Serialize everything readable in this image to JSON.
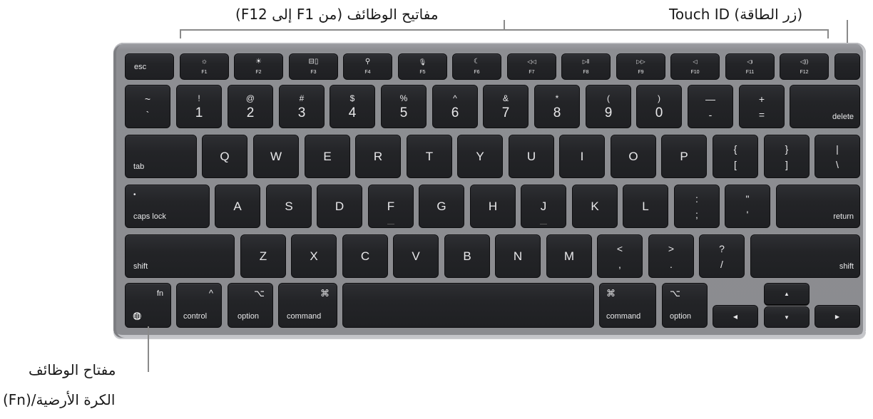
{
  "callouts": {
    "function_keys": "مفاتيح الوظائف (من F1 إلى F12)",
    "touch_id": "Touch ID (زر الطاقة)",
    "fn_line1": "مفتاح الوظائف",
    "fn_line2": "(Fn)/الكرة الأرضية"
  },
  "keyboard": {
    "row_function": [
      {
        "label": "esc"
      },
      {
        "icon": "brightness-down-icon",
        "glyph": "☼",
        "label": "F1"
      },
      {
        "icon": "brightness-up-icon",
        "glyph": "☀",
        "label": "F2"
      },
      {
        "icon": "mission-control-icon",
        "glyph": "⊟▯",
        "label": "F3"
      },
      {
        "icon": "search-icon",
        "glyph": "⚲",
        "label": "F4"
      },
      {
        "icon": "microphone-icon",
        "glyph": "🎙",
        "label": "F5"
      },
      {
        "icon": "moon-icon",
        "glyph": "☾",
        "label": "F6"
      },
      {
        "icon": "rewind-icon",
        "glyph": "◁◁",
        "label": "F7"
      },
      {
        "icon": "play-pause-icon",
        "glyph": "▷‖",
        "label": "F8"
      },
      {
        "icon": "fast-forward-icon",
        "glyph": "▷▷",
        "label": "F9"
      },
      {
        "icon": "mute-icon",
        "glyph": "◁",
        "label": "F10"
      },
      {
        "icon": "volume-down-icon",
        "glyph": "◁ı",
        "label": "F11"
      },
      {
        "icon": "volume-up-icon",
        "glyph": "◁))",
        "label": "F12"
      },
      {
        "label": ""
      }
    ],
    "row_number": [
      {
        "top": "~",
        "bottom": "`"
      },
      {
        "top": "!",
        "bottom": "1"
      },
      {
        "top": "@",
        "bottom": "2"
      },
      {
        "top": "#",
        "bottom": "3"
      },
      {
        "top": "$",
        "bottom": "4"
      },
      {
        "top": "%",
        "bottom": "5"
      },
      {
        "top": "^",
        "bottom": "6"
      },
      {
        "top": "&",
        "bottom": "7"
      },
      {
        "top": "*",
        "bottom": "8"
      },
      {
        "top": "(",
        "bottom": "9"
      },
      {
        "top": ")",
        "bottom": "0"
      },
      {
        "top": "—",
        "bottom": "-"
      },
      {
        "top": "+",
        "bottom": "="
      },
      {
        "label": "delete"
      }
    ],
    "row_top": [
      {
        "label": "tab"
      },
      {
        "label": "Q"
      },
      {
        "label": "W"
      },
      {
        "label": "E"
      },
      {
        "label": "R"
      },
      {
        "label": "T"
      },
      {
        "label": "Y"
      },
      {
        "label": "U"
      },
      {
        "label": "I"
      },
      {
        "label": "O"
      },
      {
        "label": "P"
      },
      {
        "top": "{",
        "bottom": "["
      },
      {
        "top": "}",
        "bottom": "]"
      },
      {
        "top": "|",
        "bottom": "\\"
      }
    ],
    "row_home": [
      {
        "label": "caps lock",
        "indicator": "•"
      },
      {
        "label": "A"
      },
      {
        "label": "S"
      },
      {
        "label": "D"
      },
      {
        "label": "F"
      },
      {
        "label": "G"
      },
      {
        "label": "H"
      },
      {
        "label": "J"
      },
      {
        "label": "K"
      },
      {
        "label": "L"
      },
      {
        "top": ":",
        "bottom": ";"
      },
      {
        "top": "\"",
        "bottom": "'"
      },
      {
        "label": "return"
      }
    ],
    "row_bottom": [
      {
        "label": "shift"
      },
      {
        "label": "Z"
      },
      {
        "label": "X"
      },
      {
        "label": "C"
      },
      {
        "label": "V"
      },
      {
        "label": "B"
      },
      {
        "label": "N"
      },
      {
        "label": "M"
      },
      {
        "top": "<",
        "bottom": ","
      },
      {
        "top": ">",
        "bottom": "."
      },
      {
        "top": "?",
        "bottom": "/"
      },
      {
        "label": "shift"
      }
    ],
    "row_modifier": {
      "fn": {
        "label": "fn",
        "globe": "🌐"
      },
      "control": {
        "label": "control",
        "symbol": "^"
      },
      "option_left": {
        "label": "option",
        "symbol": "⌥"
      },
      "command_left": {
        "label": "command",
        "symbol": "⌘"
      },
      "command_right": {
        "label": "command",
        "symbol": "⌘"
      },
      "option_right": {
        "label": "option",
        "symbol": "⌥"
      },
      "arrow_left": "◀",
      "arrow_up": "▲",
      "arrow_down": "▼",
      "arrow_right": "▶"
    }
  }
}
